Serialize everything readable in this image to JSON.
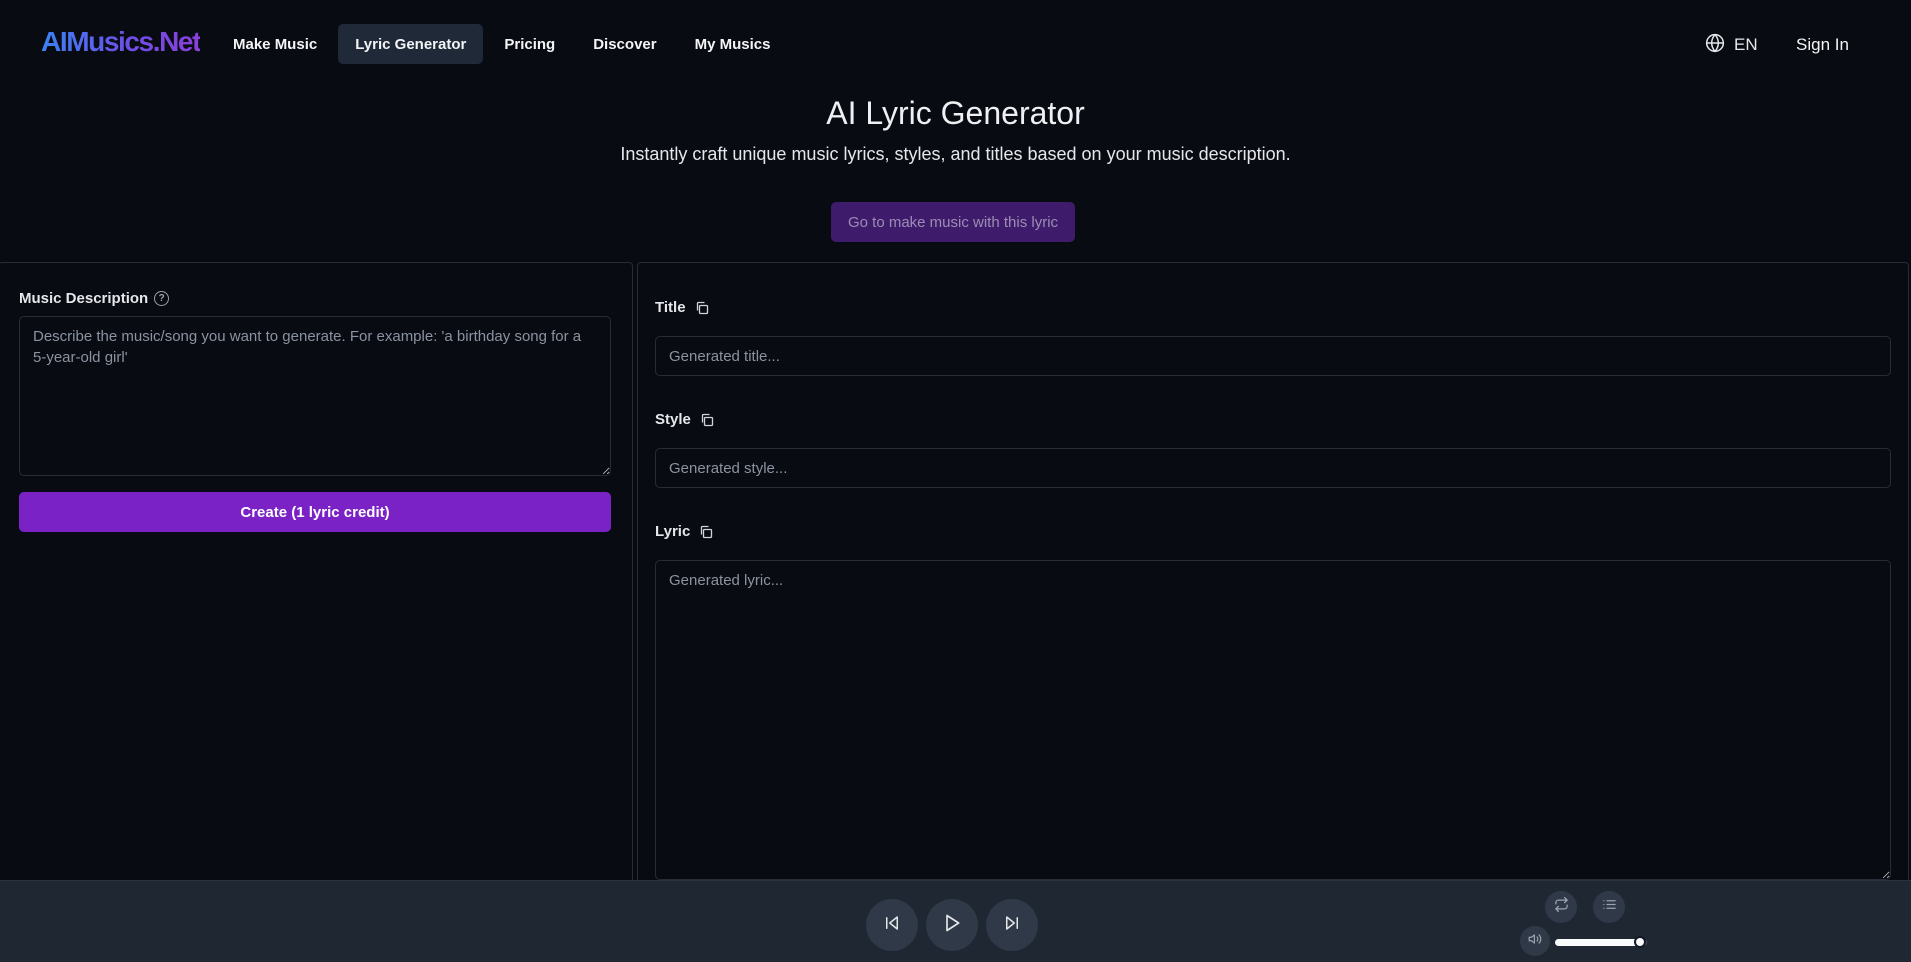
{
  "header": {
    "logo": "AIMusics.Net",
    "nav": [
      {
        "label": "Make Music",
        "active": false
      },
      {
        "label": "Lyric Generator",
        "active": true
      },
      {
        "label": "Pricing",
        "active": false
      },
      {
        "label": "Discover",
        "active": false
      },
      {
        "label": "My Musics",
        "active": false
      }
    ],
    "language": "EN",
    "sign_in": "Sign In"
  },
  "hero": {
    "title": "AI Lyric Generator",
    "subtitle": "Instantly craft unique music lyrics, styles, and titles based on your music description.",
    "goto_button": "Go to make music with this lyric"
  },
  "left_panel": {
    "description_label": "Music Description",
    "help_icon": "question-circle-icon",
    "description_value": "",
    "description_placeholder": "Describe the music/song you want to generate. For example: 'a birthday song for a 5-year-old girl'",
    "create_button": "Create (1 lyric credit)"
  },
  "right_panel": {
    "title_label": "Title",
    "title_value": "",
    "title_placeholder": "Generated title...",
    "style_label": "Style",
    "style_value": "",
    "style_placeholder": "Generated style...",
    "lyric_label": "Lyric",
    "lyric_value": "",
    "lyric_placeholder": "Generated lyric...",
    "copy_icon": "copy-icon"
  },
  "player": {
    "icons": [
      "skip-back-icon",
      "play-icon",
      "skip-forward-icon",
      "repeat-icon",
      "playlist-icon",
      "volume-icon"
    ],
    "volume": 0.92
  },
  "colors": {
    "background": "#080b11",
    "accent": "#7b22c6",
    "accent_muted": "#3f1c6b",
    "nav_active": "#1f2937",
    "player_bg": "#1f2733",
    "border": "#262d38"
  }
}
